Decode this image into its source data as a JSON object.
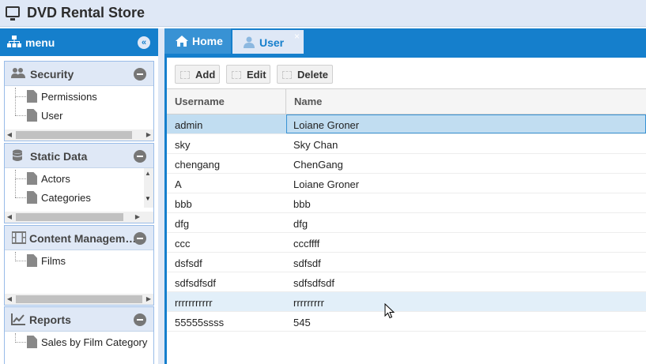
{
  "app": {
    "title": "DVD Rental Store"
  },
  "menu": {
    "label": "menu",
    "collapse_icon": "«",
    "sections": [
      {
        "title": "Security",
        "icon": "users-icon",
        "items": [
          "Permissions",
          "User"
        ]
      },
      {
        "title": "Static Data",
        "icon": "database-icon",
        "items": [
          "Actors",
          "Categories"
        ]
      },
      {
        "title": "Content Managem…",
        "icon": "film-icon",
        "items": [
          "Films"
        ]
      },
      {
        "title": "Reports",
        "icon": "chart-icon",
        "items": [
          "Sales by Film Category"
        ]
      }
    ]
  },
  "tabs": [
    {
      "label": "Home",
      "icon": "home-icon"
    },
    {
      "label": "User",
      "icon": "user-icon",
      "close": "×"
    }
  ],
  "toolbar": {
    "add": "Add",
    "edit": "Edit",
    "delete": "Delete"
  },
  "grid": {
    "columns": [
      "Username",
      "Name"
    ],
    "rows": [
      [
        "admin",
        "Loiane Groner"
      ],
      [
        "sky",
        "Sky Chan"
      ],
      [
        "chengang",
        "ChenGang"
      ],
      [
        "A",
        "Loiane Groner"
      ],
      [
        "bbb",
        "bbb"
      ],
      [
        "dfg",
        "dfg"
      ],
      [
        "ccc",
        "cccffff"
      ],
      [
        "dsfsdf",
        "sdfsdf"
      ],
      [
        "sdfsdfsdf",
        "sdfsdfsdf"
      ],
      [
        "rrrrrrrrrrr",
        "rrrrrrrrr"
      ],
      [
        "55555ssss",
        "545"
      ]
    ],
    "selected_row": 0,
    "hover_row": 9
  },
  "colors": {
    "accent": "#157fcc",
    "light": "#dfe8f6",
    "selected": "#c1ddf1"
  }
}
